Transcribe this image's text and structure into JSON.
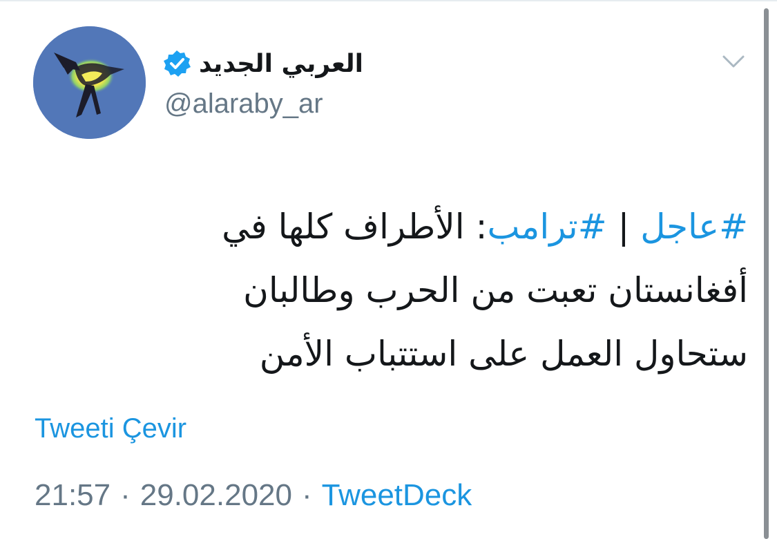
{
  "account": {
    "display_name": "العربي الجديد",
    "handle": "@alaraby_ar",
    "verified": true
  },
  "tweet": {
    "hashtag_1": "#عاجل",
    "separator": " | ",
    "hashtag_2": "#ترامب",
    "line_1_rest": ": الأطراف كلها في",
    "line_2": "أفغانستان تعبت من الحرب وطالبان",
    "line_3": "ستحاول العمل على استتباب الأمن"
  },
  "actions": {
    "translate_label": "Tweeti Çevir"
  },
  "meta": {
    "time": "21:57",
    "dot_1": "·",
    "date": "29.02.2020",
    "dot_2": "·",
    "source": "TweetDeck"
  },
  "icons": {
    "avatar": "alaraby-bird-logo-icon",
    "verified": "verified-badge-icon",
    "menu": "chevron-down-icon"
  },
  "colors": {
    "link": "#1b95e0",
    "secondary_text": "#657786",
    "primary_text": "#14171a",
    "avatar_bg": "#5277b8",
    "verified": "#1da1f2"
  }
}
